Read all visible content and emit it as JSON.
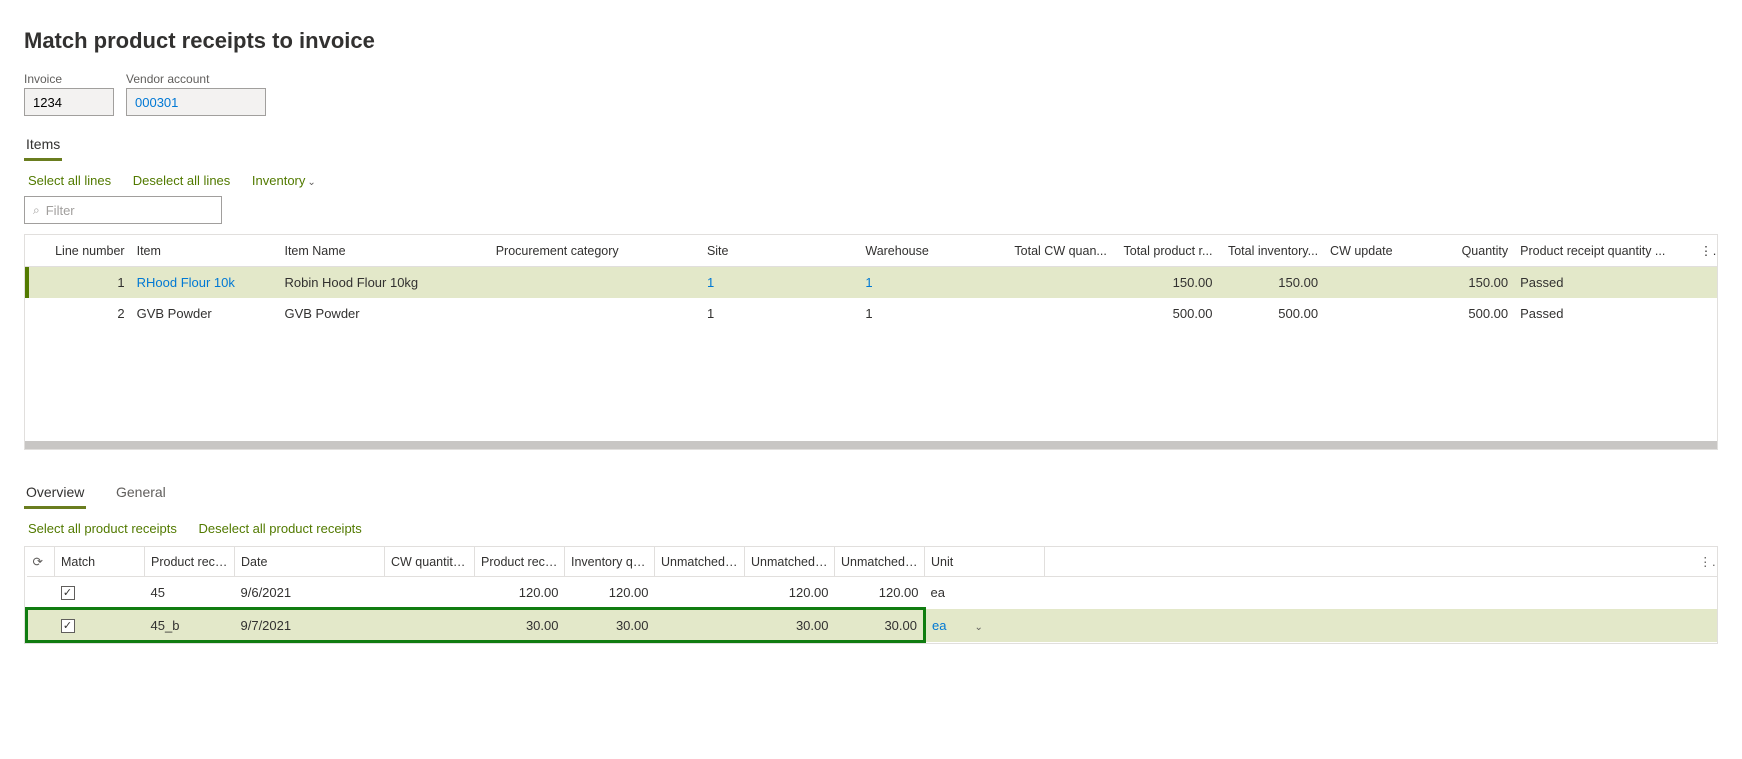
{
  "page": {
    "title": "Match product receipts to invoice"
  },
  "fields": {
    "invoice_label": "Invoice",
    "invoice_value": "1234",
    "vendor_label": "Vendor account",
    "vendor_value": "000301"
  },
  "upper": {
    "tab_items": "Items",
    "actions": {
      "select_all": "Select all lines",
      "deselect_all": "Deselect all lines",
      "inventory": "Inventory"
    },
    "filter_placeholder": "Filter",
    "headers": {
      "line_number": "Line number",
      "item": "Item",
      "item_name": "Item Name",
      "proc_cat": "Procurement category",
      "site": "Site",
      "warehouse": "Warehouse",
      "total_cw": "Total CW quan...",
      "total_pr": "Total product r...",
      "total_inv": "Total inventory...",
      "cw_update": "CW update",
      "quantity": "Quantity",
      "prq": "Product receipt quantity ..."
    },
    "rows": [
      {
        "selected": true,
        "line": "1",
        "item": "RHood Flour 10k",
        "item_name": "Robin Hood Flour 10kg",
        "proc_cat": "",
        "site": "1",
        "warehouse": "1",
        "total_cw": "",
        "total_pr": "150.00",
        "total_inv": "150.00",
        "cw_update": "",
        "quantity": "150.00",
        "prq": "Passed"
      },
      {
        "selected": false,
        "line": "2",
        "item": "GVB Powder",
        "item_name": "GVB Powder",
        "proc_cat": "",
        "site": "1",
        "warehouse": "1",
        "total_cw": "",
        "total_pr": "500.00",
        "total_inv": "500.00",
        "cw_update": "",
        "quantity": "500.00",
        "prq": "Passed"
      }
    ]
  },
  "lower": {
    "tabs": {
      "overview": "Overview",
      "general": "General"
    },
    "actions": {
      "select_all": "Select all product receipts",
      "deselect_all": "Deselect all product receipts"
    },
    "headers": {
      "match": "Match",
      "product_receipt": "Product receipt",
      "date": "Date",
      "cw_qty": "CW quantity t...",
      "pr_qty": "Product receip...",
      "inv_qty": "Inventory qua...",
      "unm_cw": "Unmatched C...",
      "unm_pr": "Unmatched pr...",
      "unm_inv": "Unmatched inv...",
      "unit": "Unit"
    },
    "rows": [
      {
        "highlighted": false,
        "match": true,
        "product_receipt": "45",
        "date": "9/6/2021",
        "cw_qty": "",
        "pr_qty": "120.00",
        "inv_qty": "120.00",
        "unm_cw": "",
        "unm_pr": "120.00",
        "unm_inv": "120.00",
        "unit": "ea"
      },
      {
        "highlighted": true,
        "match": true,
        "product_receipt": "45_b",
        "date": "9/7/2021",
        "cw_qty": "",
        "pr_qty": "30.00",
        "inv_qty": "30.00",
        "unm_cw": "",
        "unm_pr": "30.00",
        "unm_inv": "30.00",
        "unit": "ea"
      }
    ]
  }
}
